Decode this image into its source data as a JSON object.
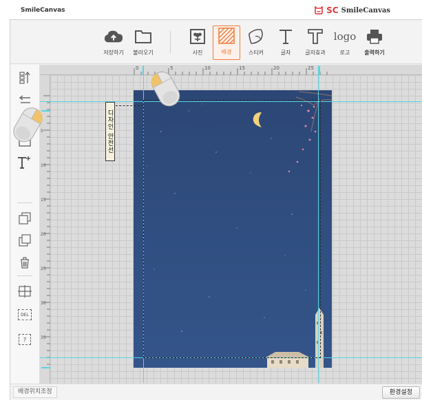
{
  "app": {
    "title": "SmileCanvas",
    "brand_mark": "SC",
    "brand_name": "SmileCanvas",
    "accent": "#f07b3b",
    "brand_color": "#e0393e"
  },
  "toolbar": {
    "save": "저장하기",
    "load": "불러오기",
    "photo": "사진",
    "background": "배경",
    "sticker": "스티커",
    "text": "글자",
    "text_effect": "글자효과",
    "logo": "로고",
    "logo_glyph": "logo",
    "print": "출력하기",
    "active_tool": "background"
  },
  "sidebar": {
    "icons": [
      "align-vertical-icon",
      "undo-icon",
      "image-icon",
      "add-text-icon",
      "bring-forward-icon",
      "send-backward-icon",
      "trash-icon",
      "grid-icon",
      "delete-label-icon",
      "help-icon"
    ],
    "del_label": "DEL",
    "help_label": "?"
  },
  "rulers": {
    "top": [
      "0",
      "5",
      "10",
      "15",
      "20",
      "25"
    ],
    "left": [
      "5",
      "10",
      "15",
      "20",
      "25",
      "30",
      "35"
    ]
  },
  "canvas": {
    "tag_text": "디자인 안전선",
    "bg_color": "#2e4a78",
    "guide_color": "#56d5e3"
  },
  "status": {
    "left_label": "배경위치조정",
    "right_button": "환경설정"
  }
}
